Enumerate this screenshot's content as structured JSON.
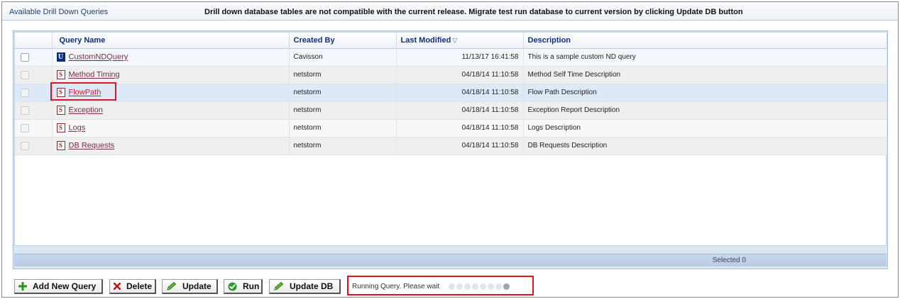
{
  "header": {
    "title": "Available Drill Down Queries",
    "warning": "Drill down database tables are not compatible with the current release. Migrate test run database to current version by clicking Update DB button"
  },
  "table": {
    "columns": {
      "name": "Query  Name",
      "created_by": "Created By",
      "last_modified": "Last Modified",
      "description": "Description"
    },
    "sort_indicator": "▽",
    "rows": [
      {
        "type": "U",
        "name": "CustomNDQuery",
        "created_by": "Cavisson",
        "last_modified": "11/13/17 16:41:58",
        "description": "This is a sample custom ND query"
      },
      {
        "type": "S",
        "name": "Method Timing",
        "created_by": "netstorm",
        "last_modified": "04/18/14 11:10:58",
        "description": "Method Self Time Description"
      },
      {
        "type": "S",
        "name": "FlowPath",
        "created_by": "netstorm",
        "last_modified": "04/18/14 11:10:58",
        "description": "Flow Path Description"
      },
      {
        "type": "S",
        "name": "Exception",
        "created_by": "netstorm",
        "last_modified": "04/18/14 11:10:58",
        "description": "Exception Report Description"
      },
      {
        "type": "S",
        "name": "Logs",
        "created_by": "netstorm",
        "last_modified": "04/18/14 11:10:58",
        "description": "Logs Description"
      },
      {
        "type": "S",
        "name": "DB Requests",
        "created_by": "netstorm",
        "last_modified": "04/18/14 11:10:58",
        "description": "DB Requests Description"
      }
    ]
  },
  "status": {
    "selected": "Selected 0"
  },
  "toolbar": {
    "add_label": "Add New Query",
    "delete_label": "Delete",
    "update_label": "Update",
    "run_label": "Run",
    "update_db_label": "Update DB"
  },
  "running": {
    "text": "Running Query. Please wait"
  },
  "colors": {
    "highlight": "#e3111b",
    "header_text": "#0f2f7a",
    "link": "#7a2d45"
  }
}
